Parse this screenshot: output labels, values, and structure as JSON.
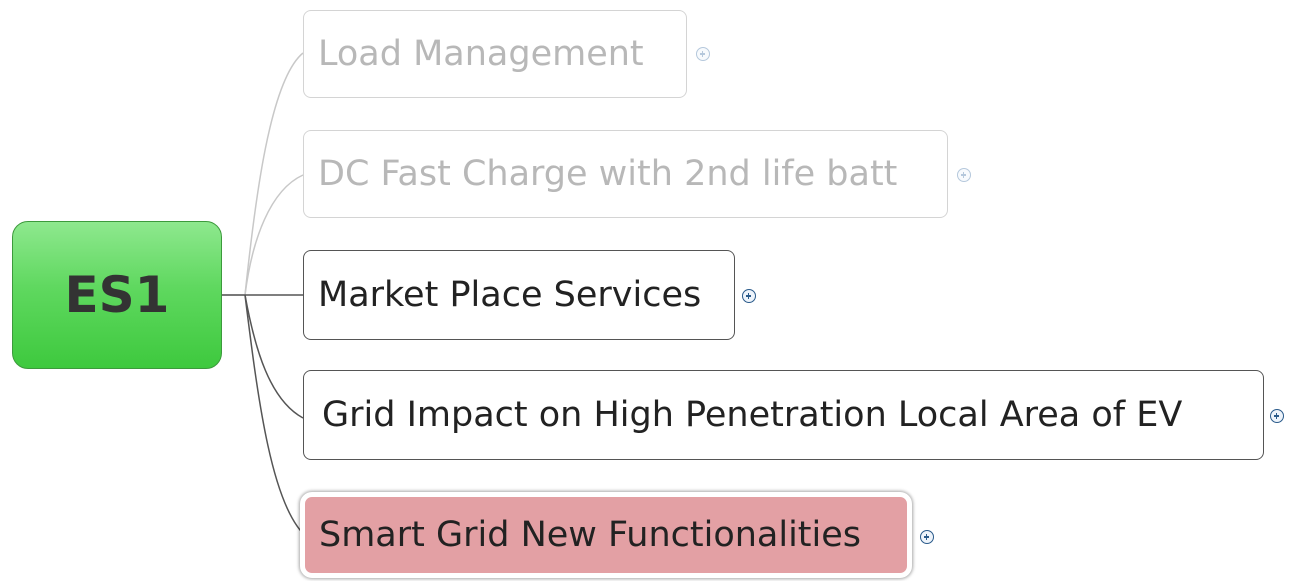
{
  "root": {
    "label": "ES1",
    "color": "#5fd85f"
  },
  "topics": [
    {
      "label": "Load Management",
      "state": "faded",
      "expander_icon": "plus-circle-icon"
    },
    {
      "label": "DC Fast Charge with 2nd life batt",
      "state": "faded",
      "expander_icon": "plus-circle-icon"
    },
    {
      "label": "Market Place Services",
      "state": "normal",
      "expander_icon": "plus-circle-icon"
    },
    {
      "label": "Grid Impact on High Penetration Local Area of EV",
      "state": "normal",
      "expander_icon": "plus-circle-icon"
    },
    {
      "label": "Smart Grid New Functionalities",
      "state": "selected",
      "expander_icon": "plus-circle-icon",
      "color": "#e3a0a4"
    }
  ]
}
